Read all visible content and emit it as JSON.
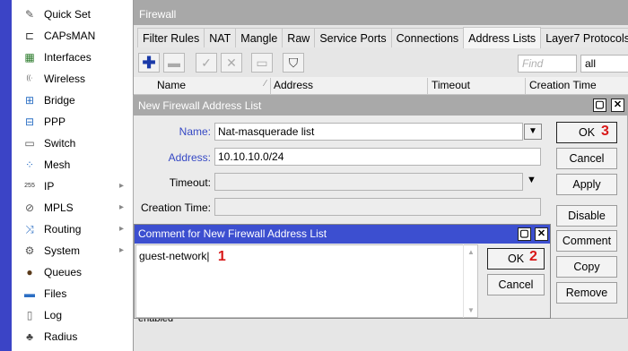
{
  "sidebar": {
    "items": [
      {
        "label": "Quick Set",
        "icon": "quick-set-icon",
        "glyph": "✎",
        "color": "#555555",
        "submenu": false
      },
      {
        "label": "CAPsMAN",
        "icon": "capsman-icon",
        "glyph": "⊏",
        "color": "#333333",
        "submenu": false
      },
      {
        "label": "Interfaces",
        "icon": "interfaces-icon",
        "glyph": "▦",
        "color": "#2a7a2a",
        "submenu": false
      },
      {
        "label": "Wireless",
        "icon": "wireless-icon",
        "glyph": "((·",
        "color": "#444444",
        "submenu": false
      },
      {
        "label": "Bridge",
        "icon": "bridge-icon",
        "glyph": "⊞",
        "color": "#2c6fc4",
        "submenu": false
      },
      {
        "label": "PPP",
        "icon": "ppp-icon",
        "glyph": "⊟",
        "color": "#2c6fc4",
        "submenu": false
      },
      {
        "label": "Switch",
        "icon": "switch-icon",
        "glyph": "▭",
        "color": "#555555",
        "submenu": false
      },
      {
        "label": "Mesh",
        "icon": "mesh-icon",
        "glyph": "⁘",
        "color": "#2c6fc4",
        "submenu": false
      },
      {
        "label": "IP",
        "icon": "ip-icon",
        "glyph": "255",
        "color": "#333333",
        "submenu": true
      },
      {
        "label": "MPLS",
        "icon": "mpls-icon",
        "glyph": "⊘",
        "color": "#555555",
        "submenu": true
      },
      {
        "label": "Routing",
        "icon": "routing-icon",
        "glyph": "⤨",
        "color": "#2c6fc4",
        "submenu": true
      },
      {
        "label": "System",
        "icon": "system-icon",
        "glyph": "⚙",
        "color": "#555555",
        "submenu": true
      },
      {
        "label": "Queues",
        "icon": "queues-icon",
        "glyph": "●",
        "color": "#5a3a1a",
        "submenu": false
      },
      {
        "label": "Files",
        "icon": "files-icon",
        "glyph": "▬",
        "color": "#2c6fc4",
        "submenu": false
      },
      {
        "label": "Log",
        "icon": "log-icon",
        "glyph": "▯",
        "color": "#666666",
        "submenu": false
      },
      {
        "label": "Radius",
        "icon": "radius-icon",
        "glyph": "♣",
        "color": "#444444",
        "submenu": false
      }
    ]
  },
  "firewall": {
    "title": "Firewall",
    "tabs": [
      "Filter Rules",
      "NAT",
      "Mangle",
      "Raw",
      "Service Ports",
      "Connections",
      "Address Lists",
      "Layer7 Protocols"
    ],
    "active_tab": "Address Lists",
    "find_placeholder": "Find",
    "filter_value": "all",
    "columns": [
      "Name",
      "Address",
      "Timeout",
      "Creation Time"
    ],
    "status": "enabled"
  },
  "address_dialog": {
    "title": "New Firewall Address List",
    "name_label": "Name:",
    "name_value": "Nat-masquerade list",
    "address_label": "Address:",
    "address_value": "10.10.10.0/24",
    "timeout_label": "Timeout:",
    "creation_time_label": "Creation Time:",
    "buttons": {
      "ok": "OK",
      "cancel": "Cancel",
      "apply": "Apply",
      "disable": "Disable",
      "comment": "Comment",
      "copy": "Copy",
      "remove": "Remove"
    },
    "ok_step": "3"
  },
  "comment_dialog": {
    "title": "Comment for New Firewall Address List",
    "text": "guest-network",
    "text_step": "1",
    "ok": "OK",
    "ok_step": "2",
    "cancel": "Cancel"
  },
  "colors": {
    "sidebar_strip": "#3b44c6",
    "active_title": "#3c4fd0",
    "inactive_title": "#a9a9a9",
    "annotation": "#d81818",
    "field_label_blue": "#3548c4",
    "add_button": "#1a3aa8"
  }
}
